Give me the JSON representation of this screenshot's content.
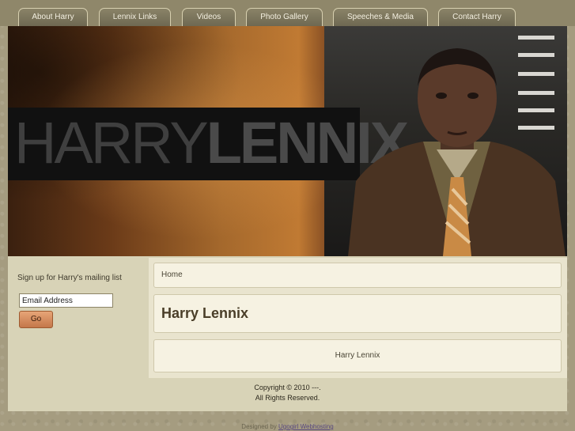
{
  "nav": {
    "tabs": [
      {
        "label": "About Harry"
      },
      {
        "label": "Lennix Links"
      },
      {
        "label": "Videos"
      },
      {
        "label": "Photo Gallery"
      },
      {
        "label": "Speeches & Media"
      },
      {
        "label": "Contact Harry"
      }
    ]
  },
  "banner": {
    "logo_light": "HARRY",
    "logo_bold": "LENNIX"
  },
  "sidebar": {
    "signup_text": "Sign up for Harry's mailing list",
    "email_value": "Email Address",
    "go_label": "Go"
  },
  "main": {
    "breadcrumb": "Home",
    "title": "Harry Lennix",
    "content_text": "Harry Lennix"
  },
  "footer": {
    "copyright": "Copyright © 2010 ---.",
    "rights": "All Rights Reserved.",
    "designed_by": "Designed by",
    "designer_link": "Ugogirl Webhosting"
  },
  "colors": {
    "accent": "#c4774a",
    "panel": "#f6f2e2",
    "frame": "#d8d3b7"
  }
}
